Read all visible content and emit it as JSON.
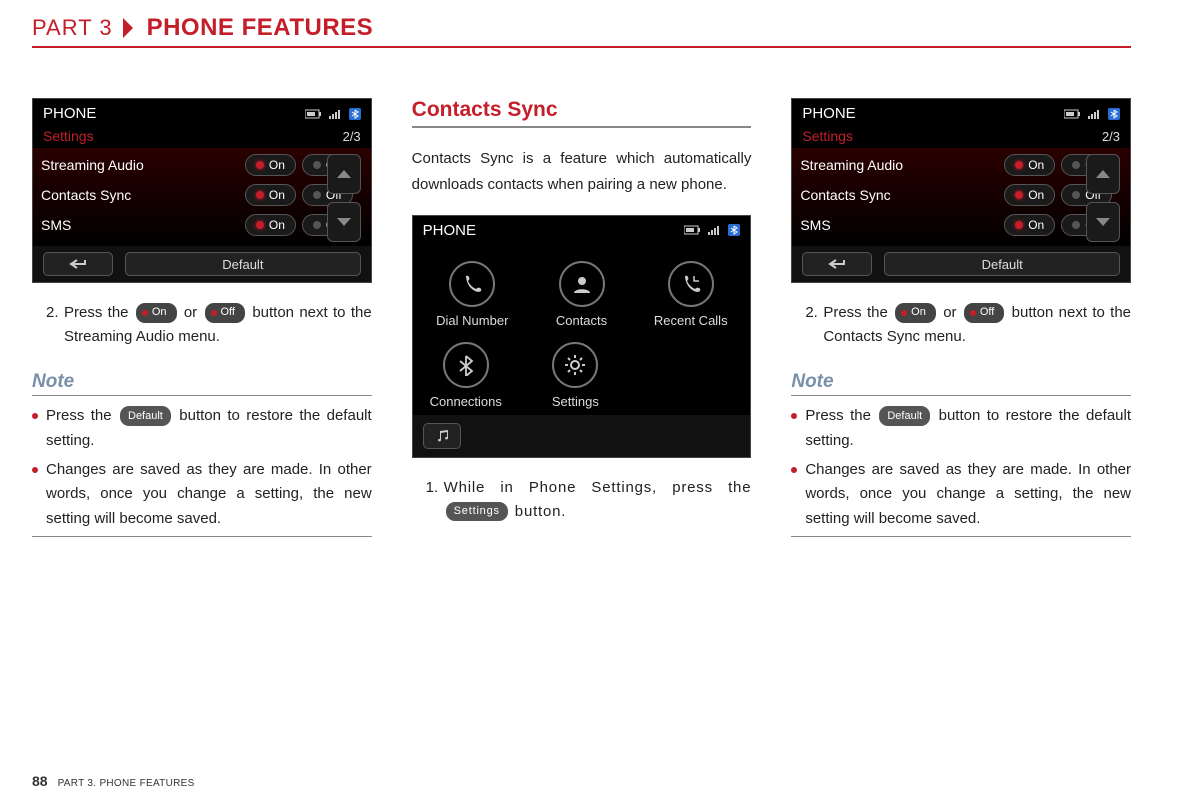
{
  "header": {
    "part": "PART 3",
    "chapter": "PHONE FEATURES"
  },
  "footer": {
    "page": "88",
    "text": "PART 3. PHONE FEATURES"
  },
  "buttons": {
    "on": "On",
    "off": "Off",
    "default": "Default",
    "settings": "Settings"
  },
  "shot_settings": {
    "title": "PHONE",
    "subtitle": "Settings",
    "page": "2/3",
    "rows": [
      {
        "label": "Streaming Audio"
      },
      {
        "label": "Contacts Sync"
      },
      {
        "label": "SMS"
      }
    ],
    "bottom_default": "Default"
  },
  "col1": {
    "step_num": "2.",
    "step_a": "Press the ",
    "step_b": " or ",
    "step_c": " button next to the Streaming Audio menu.",
    "note": "Note",
    "n1a": "Press the ",
    "n1b": " button to restore the default setting.",
    "n2": "Changes are saved as they are made. In other words, once you change a setting, the new setting will become saved."
  },
  "col2": {
    "section": "Contacts Sync",
    "intro": "Contacts Sync is a feature which automatically downloads contacts when pairing a new phone.",
    "shot_title": "PHONE",
    "icons": [
      "Dial Number",
      "Contacts",
      "Recent Calls",
      "Connections",
      "Settings"
    ],
    "step_num": "1.",
    "step_a": "While in Phone Settings, press the ",
    "step_b": " button."
  },
  "col3": {
    "step_num": "2.",
    "step_a": "Press the ",
    "step_b": " or ",
    "step_c": " button next to the Contacts Sync menu.",
    "note": "Note",
    "n1a": "Press the ",
    "n1b": " button to restore the default setting.",
    "n2": "Changes are saved as they are made. In other words, once you change a setting, the new setting will become saved."
  }
}
